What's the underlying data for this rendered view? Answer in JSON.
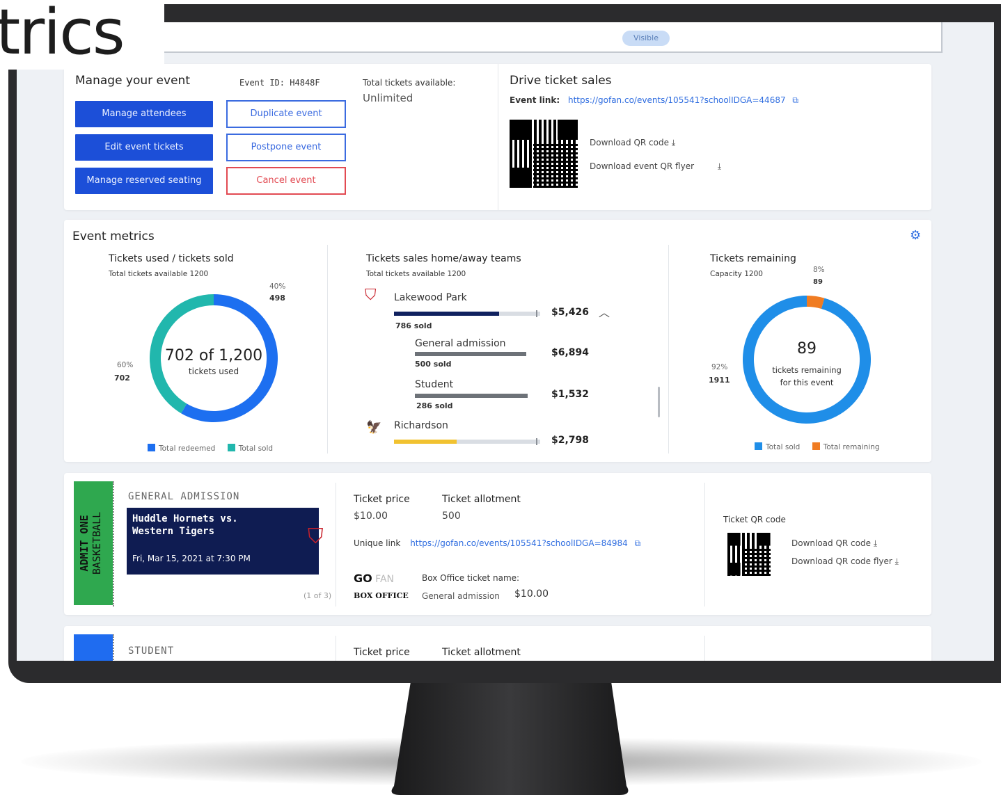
{
  "title_overlay": "trics",
  "status_pill": "Visible",
  "manage": {
    "heading": "Manage your event",
    "event_id_label": "Event ID:",
    "event_id": "H4848F",
    "total_available_label": "Total tickets available:",
    "total_available": "Unlimited",
    "buttons": {
      "manage_attendees": "Manage attendees",
      "edit_tickets": "Edit event tickets",
      "reserved_seating": "Manage reserved seating",
      "duplicate": "Duplicate event",
      "postpone": "Postpone event",
      "cancel": "Cancel event"
    }
  },
  "drive": {
    "heading": "Drive ticket sales",
    "event_link_label": "Event link:",
    "event_link": "https://gofan.co/events/105541?schoolIDGA=44687",
    "download_qr": "Download QR code",
    "download_flyer": "Download event QR flyer"
  },
  "metrics": {
    "heading": "Event metrics",
    "gear_icon": "gear-icon",
    "used_sold": {
      "title": "Tickets used / tickets sold",
      "subtitle": "Total tickets available 1200",
      "center_value": "702 of 1,200",
      "center_label": "tickets used",
      "top_pct": "40%",
      "top_value": "498",
      "left_pct": "60%",
      "left_value": "702",
      "legend": [
        "Total redeemed",
        "Total sold"
      ],
      "colors": [
        "#1d6ff0",
        "#21b7ad"
      ]
    },
    "home_away": {
      "title": "Tickets sales home/away teams",
      "subtitle": "Total tickets available 1200",
      "teams": [
        {
          "name": "Lakewood Park",
          "amount": "$5,426",
          "sold": "786 sold",
          "fraction": 0.72,
          "color": "#10215f"
        },
        {
          "name": "General admission",
          "amount": "$6,894",
          "sold": "500 sold",
          "fraction": 1.0,
          "color": "#6d7278"
        },
        {
          "name": "Student",
          "amount": "$1,532",
          "sold": "286 sold",
          "fraction": 1.0,
          "color": "#6d7278"
        },
        {
          "name": "Richardson",
          "amount": "$2,798",
          "sold": "",
          "fraction": 0.43,
          "color": "#f1c230"
        }
      ]
    },
    "remaining": {
      "title": "Tickets remaining",
      "subtitle": "Capacity 1200",
      "center_value": "89",
      "center_label_1": "tickets remaining",
      "center_label_2": "for this event",
      "top_pct": "8%",
      "top_value": "89",
      "left_pct": "92%",
      "left_value": "1911",
      "legend": [
        "Total sold",
        "Total remaining"
      ],
      "colors": [
        "#1f8ee8",
        "#f07c22"
      ]
    }
  },
  "chart_data": [
    {
      "type": "pie",
      "title": "Tickets used / tickets sold",
      "labels": [
        "Total redeemed",
        "Total sold"
      ],
      "values": [
        702,
        498
      ],
      "percents": [
        60,
        40
      ]
    },
    {
      "type": "bar",
      "title": "Tickets sales home/away teams",
      "categories": [
        "Lakewood Park",
        "General admission",
        "Student",
        "Richardson"
      ],
      "values": [
        5426,
        6894,
        1532,
        2798
      ],
      "sold": [
        786,
        500,
        286,
        null
      ]
    },
    {
      "type": "pie",
      "title": "Tickets remaining",
      "labels": [
        "Total sold",
        "Total remaining"
      ],
      "values": [
        1911,
        89
      ],
      "percents": [
        92,
        8
      ]
    }
  ],
  "ticket1": {
    "stub_text_1": "ADMIT ONE",
    "stub_text_2": "BASKETBALL",
    "category": "GENERAL ADMISSION",
    "event_line_1": "Huddle Hornets vs.",
    "event_line_2": "Western Tigers",
    "date": "Fri, Mar 15, 2021 at 7:30 PM",
    "page": "(1 of 3)",
    "price_label": "Ticket price",
    "price": "$10.00",
    "allotment_label": "Ticket allotment",
    "allotment": "500",
    "unique_link_label": "Unique link",
    "unique_link": "https://gofan.co/events/105541?schoolIDGA=84984",
    "box_office_logo_1": "GO",
    "box_office_logo_2": "BOX OFFICE",
    "box_office_name_label": "Box Office ticket name:",
    "box_office_name": "General admission",
    "box_office_price": "$10.00",
    "qr_label": "Ticket QR code",
    "download_qr": "Download QR code",
    "download_flyer": "Download QR code flyer"
  },
  "ticket2": {
    "category": "STUDENT",
    "price_label": "Ticket price",
    "allotment_label": "Ticket allotment"
  }
}
